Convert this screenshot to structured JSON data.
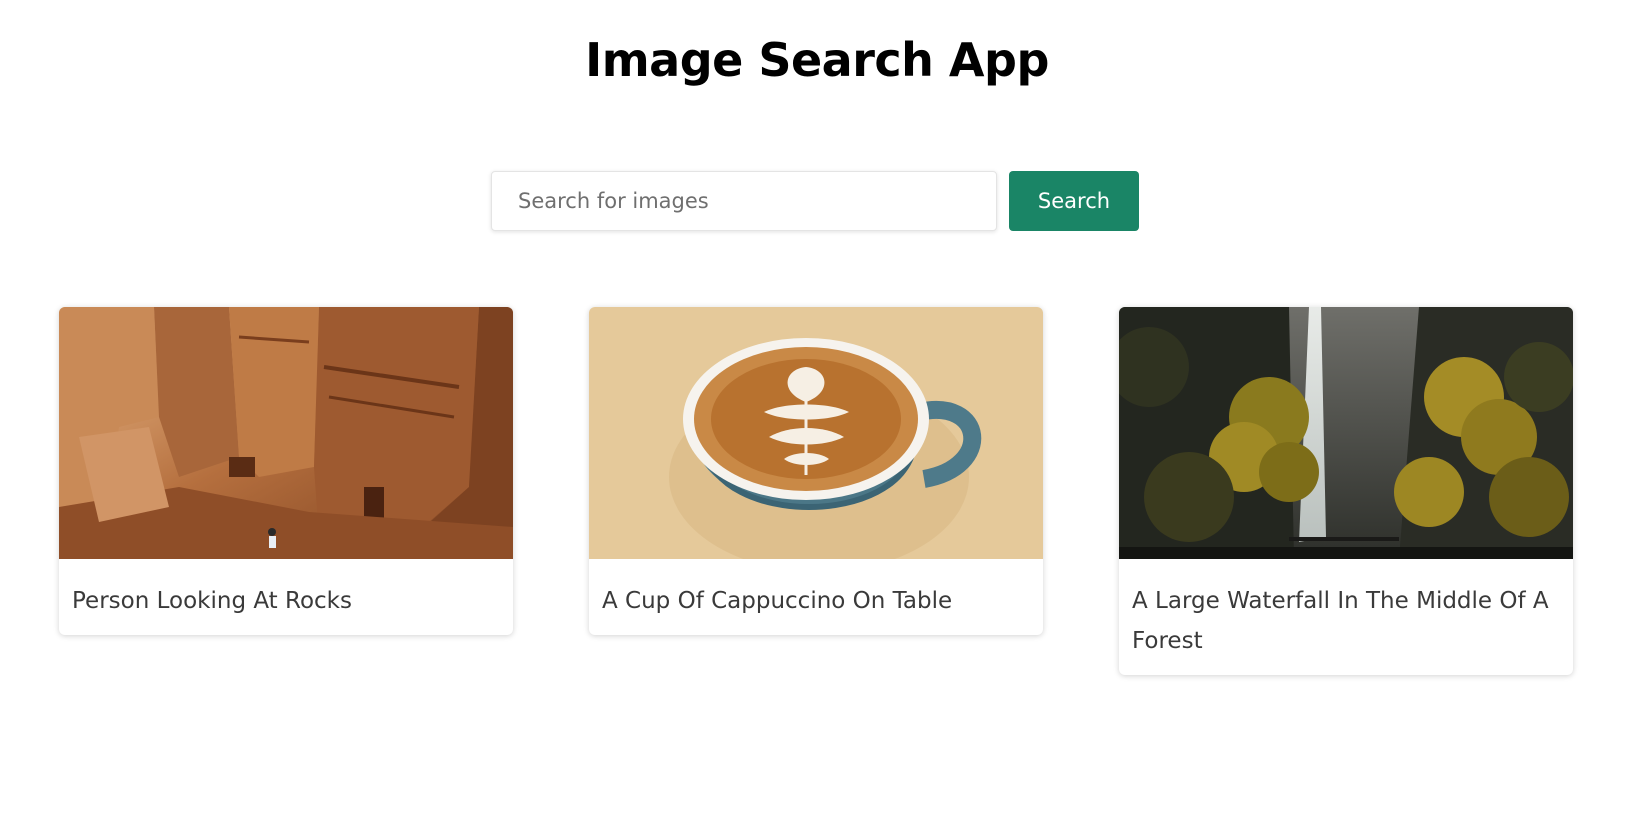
{
  "app": {
    "title": "Image Search App"
  },
  "search": {
    "placeholder": "Search for images",
    "value": "",
    "button_label": "Search"
  },
  "colors": {
    "accent": "#1a8566"
  },
  "results": [
    {
      "caption": "Person Looking At Rocks",
      "image": "rock-canyon-photo"
    },
    {
      "caption": "A Cup Of Cappuccino On Table",
      "image": "cappuccino-photo"
    },
    {
      "caption": "A Large Waterfall In The Middle Of A Forest",
      "image": "waterfall-forest-photo"
    }
  ]
}
